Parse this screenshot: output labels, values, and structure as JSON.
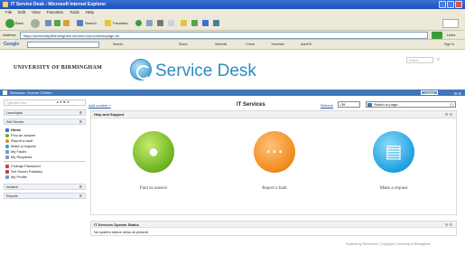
{
  "browser": {
    "title": "IT Service Desk - Microsoft Internet Explorer",
    "menu": [
      "File",
      "Edit",
      "View",
      "Favorites",
      "Tools",
      "Help"
    ],
    "toolbar": {
      "back": "Back",
      "search": "Search",
      "favorites": "Favorites"
    },
    "address_label": "Address",
    "address": "https://universityofbirmingham.service-now.com/navpage.do",
    "go": "Go",
    "links": "Links",
    "google_logo": "Google",
    "google_bar": [
      "Search",
      "Share",
      "Sidewiki",
      "Check",
      "Translate",
      "AutoFill",
      "Sign In"
    ]
  },
  "site": {
    "university": "UNIVERSITY OF BIRMINGHAM",
    "logo_text": "Service Desk",
    "search_placeholder": "Search",
    "welcome": "Welcome: Yvonne O'Brien",
    "logout": "Logout"
  },
  "sidebar": {
    "search_placeholder": "Type filter text",
    "sections": {
      "launchpad": "Launchpad",
      "self_service": "Self-Service",
      "incident": "Incident",
      "reports": "Reports"
    },
    "items": [
      "Home",
      "Find an answer",
      "Report a fault",
      "Make a request",
      "My Faults",
      "My Requests",
      "Change Password",
      "Set Secret Passkey",
      "My Profile"
    ]
  },
  "main": {
    "add_content": "Add content »",
    "title": "IT Services",
    "refresh_label": "Refresh",
    "refresh_value": "Off",
    "switch_page": "Switch to page...",
    "help_panel_title": "Help and Support",
    "tiles": [
      "Find an answer",
      "Report a fault",
      "Make a request"
    ],
    "status_panel_title": "IT Services System Status",
    "status_message": "No system status news at present"
  },
  "footer": "Powered by ServiceNow  |  Copyright © University of Birmingham"
}
